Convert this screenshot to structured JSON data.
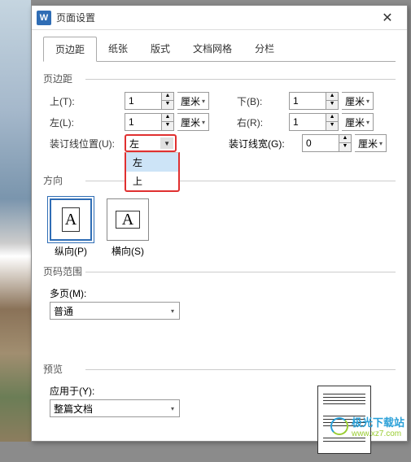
{
  "window": {
    "title": "页面设置",
    "close": "✕",
    "app_letter": "W"
  },
  "tabs": [
    "页边距",
    "纸张",
    "版式",
    "文档网格",
    "分栏"
  ],
  "margins": {
    "section": "页边距",
    "top_label": "上(T):",
    "top_value": "1",
    "top_unit": "厘米",
    "bottom_label": "下(B):",
    "bottom_value": "1",
    "bottom_unit": "厘米",
    "left_label": "左(L):",
    "left_value": "1",
    "left_unit": "厘米",
    "right_label": "右(R):",
    "right_value": "1",
    "right_unit": "厘米",
    "gutter_pos_label": "装订线位置(U):",
    "gutter_pos_value": "左",
    "gutter_pos_options": [
      "左",
      "上"
    ],
    "gutter_width_label": "装订线宽(G):",
    "gutter_width_value": "0",
    "gutter_width_unit": "厘米"
  },
  "orientation": {
    "section": "方向",
    "portrait": "纵向(P)",
    "landscape": "横向(S)",
    "letter": "A"
  },
  "page_range": {
    "section": "页码范围",
    "multi_label": "多页(M):",
    "multi_value": "普通"
  },
  "preview": {
    "section": "预览",
    "apply_label": "应用于(Y):",
    "apply_value": "整篇文档"
  },
  "watermark": {
    "line1": "极光下载站",
    "line2": "www.xz7.com"
  }
}
